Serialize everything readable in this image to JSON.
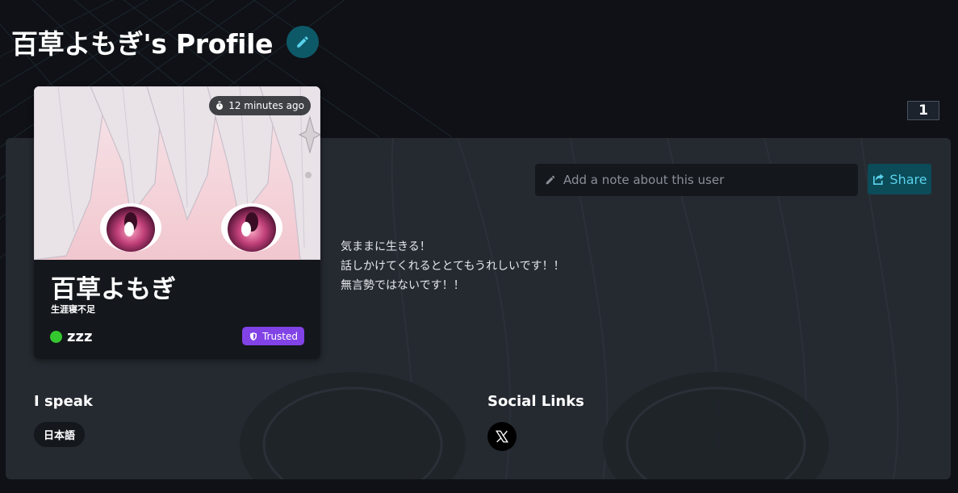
{
  "page": {
    "title": "百草よもぎ's Profile",
    "count_badge": "1"
  },
  "card": {
    "last_seen": "12 minutes ago",
    "display_name": "百草よもぎ",
    "status_description": "生涯寝不足",
    "status": "zzz",
    "status_color": "#35c72f",
    "trust_label": "Trusted",
    "trust_color": "#8143e6"
  },
  "note": {
    "placeholder": "Add a note about this user",
    "value": ""
  },
  "share": {
    "label": "Share"
  },
  "bio": {
    "lines": [
      "気ままに生きる！",
      "話しかけてくれるととてもうれしいです！！",
      "無言勢ではないです！！"
    ]
  },
  "languages": {
    "heading": "I speak",
    "items": [
      "日本語"
    ]
  },
  "social": {
    "heading": "Social Links",
    "links": [
      {
        "icon": "x-logo-icon"
      }
    ]
  },
  "icons": {
    "edit": "pencil-icon",
    "timer": "stopwatch-icon",
    "trusted": "shield-icon",
    "note": "pencil-icon",
    "share": "share-icon"
  },
  "colors": {
    "accent": "#59d2ea",
    "edit_button_bg": "#0d5968",
    "share_button_bg": "#0c4b58"
  }
}
